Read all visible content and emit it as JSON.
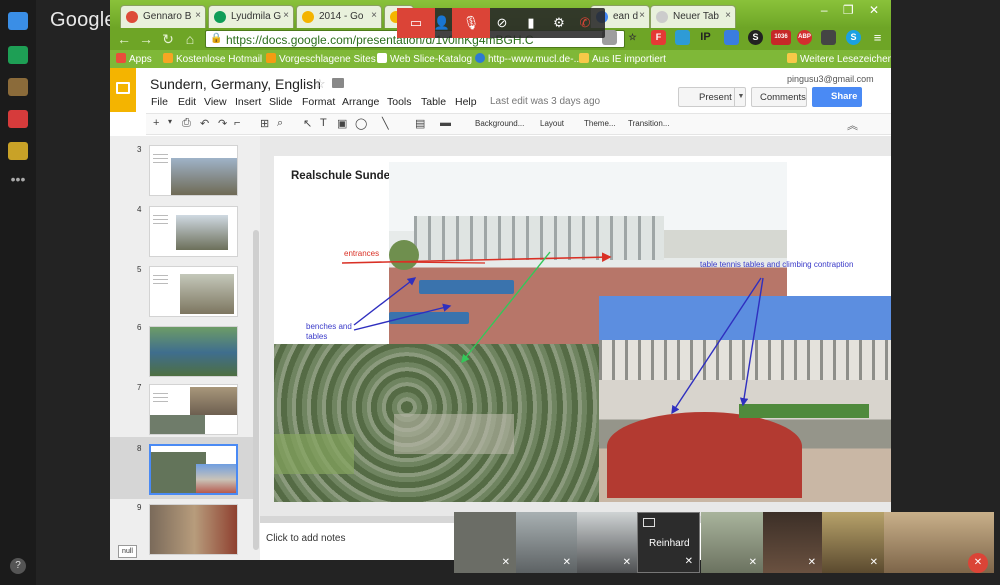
{
  "app": {
    "logo": "Google"
  },
  "tabs": [
    {
      "label": "Gennaro B",
      "favicon_color": "#dd4b39"
    },
    {
      "label": "Lyudmila G",
      "favicon_color": "#0f9d58"
    },
    {
      "label": "2014 - Go",
      "favicon_color": "#f4b400"
    },
    {
      "label": "",
      "favicon_color": "#f4b400"
    },
    {
      "label": "ean d",
      "favicon_color": "#4285f4"
    },
    {
      "label": "Neuer Tab",
      "favicon_color": "#cccccc"
    }
  ],
  "window_controls": "– ❐ ✕",
  "address_bar": {
    "url": "https://docs.google.com/presentation/d/1v0lnKg4mBGH.C"
  },
  "bookmarks": [
    {
      "label": "Apps",
      "color": "#e94e3b"
    },
    {
      "label": "Kostenlose Hotmail",
      "color": "#f5a623"
    },
    {
      "label": "Vorgeschlagene Sites",
      "color": "#f39c12"
    },
    {
      "label": "Web Slice-Katalog",
      "color": "#3f8ee0"
    },
    {
      "label": "http--www.mucl.de-...",
      "color": "#2e7ad1"
    },
    {
      "label": "Aus IE importiert",
      "color": "#f7c948"
    },
    {
      "label": "Weitere Lesezeichen",
      "color": "#f7c948"
    }
  ],
  "extensions": [
    {
      "text": "☆",
      "color": "#ffffff"
    },
    {
      "text": "F",
      "color": "#e53935"
    },
    {
      "text": "",
      "color": "#2e9bd6"
    },
    {
      "text": "IP",
      "color": "#333333"
    },
    {
      "text": "",
      "color": "#3a7de0"
    },
    {
      "text": "S",
      "color": "#222222"
    },
    {
      "text": "1036",
      "color": "#c62828"
    },
    {
      "text": "ABP",
      "color": "#d32f2f"
    },
    {
      "text": "",
      "color": "#444444"
    },
    {
      "text": "S",
      "color": "#1ba1e2"
    },
    {
      "text": "≡",
      "color": "#ffffff"
    }
  ],
  "docs": {
    "title": "Sundern, Germany, English",
    "account": "pingusu3@gmail.com",
    "menus": [
      "File",
      "Edit",
      "View",
      "Insert",
      "Slide",
      "Format",
      "Arrange",
      "Tools",
      "Table",
      "Help"
    ],
    "last_edit": "Last edit was 3 days ago",
    "present_label": "Present",
    "comments_label": "Comments",
    "share_label": "Share",
    "toolbar_menus": [
      "Background...",
      "Layout",
      "Theme...",
      "Transition..."
    ]
  },
  "filmstrip": [
    {
      "num": "3"
    },
    {
      "num": "4"
    },
    {
      "num": "5"
    },
    {
      "num": "6"
    },
    {
      "num": "7"
    },
    {
      "num": "8"
    },
    {
      "num": "9"
    }
  ],
  "filmstrip_selected": "8",
  "null_label": "null",
  "slide": {
    "title": "Realschule Sundern, our school",
    "annotations": {
      "entrances": "entrances",
      "benches": "benches and",
      "tables": "tables",
      "tabletennis": "table tennis tables and climbing contraption"
    },
    "arrow_colors": {
      "red": "#d93025",
      "blue": "#2f2fbf",
      "green": "#34c759"
    }
  },
  "notes_placeholder": "Click to add notes",
  "video": {
    "participants": [
      {
        "name": "",
        "bg": "#6b6d66"
      },
      {
        "name": "",
        "bg": "#8a8f8d"
      },
      {
        "name": "",
        "bg": "#5c5e60"
      },
      {
        "name": "Reinhard",
        "bg": "#2c2c2c"
      },
      {
        "name": "",
        "bg": "#8e9a83"
      },
      {
        "name": "",
        "bg": "#4b3a2e"
      },
      {
        "name": "",
        "bg": "#7a6a3e"
      },
      {
        "name": "",
        "bg": "#9b8466"
      }
    ]
  }
}
